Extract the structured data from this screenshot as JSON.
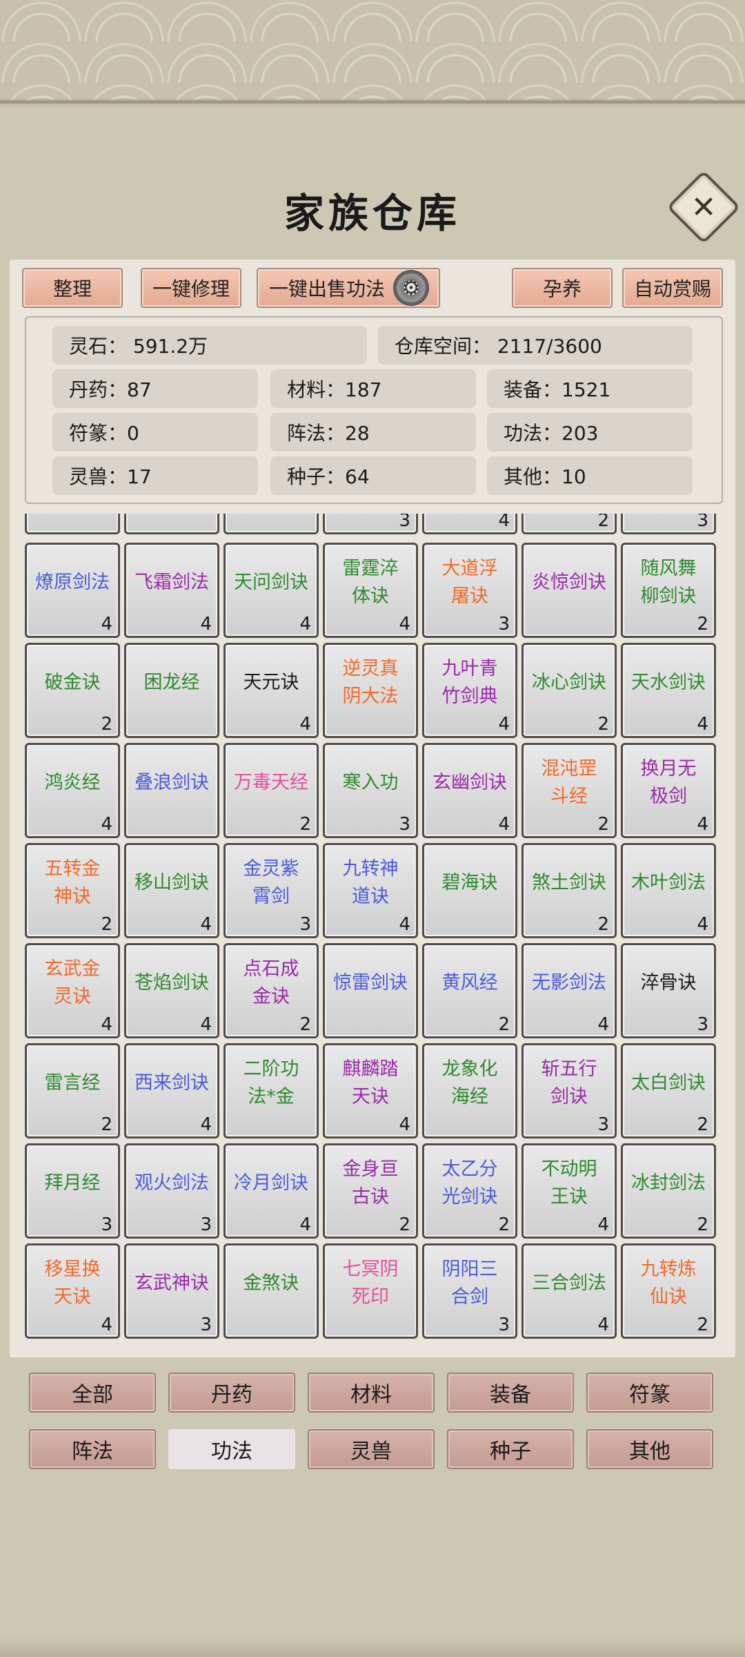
{
  "title": "家族仓库",
  "toolbar": {
    "sort": "整理",
    "repair": "一键修理",
    "sell": "一键出售功法",
    "breed": "孕养",
    "reward": "自动赏赐"
  },
  "stats": {
    "spirit_stone": "灵石：  591.2万",
    "space": "仓库空间：   2117/3600",
    "pills": "丹药：87",
    "materials": "材料：187",
    "equipment": "装备：1521",
    "talismans": "符篆：0",
    "formations": "阵法：28",
    "techniques": "功法：203",
    "beasts": "灵兽：17",
    "seeds": "种子：64",
    "others": "其他：10"
  },
  "partial_row": [
    "",
    "",
    "",
    "3",
    "4",
    "2",
    "3"
  ],
  "colors": {
    "green": "#2f8a2f",
    "blue": "#4b5bd8",
    "purple": "#9a2aa8",
    "orange": "#f06a2a",
    "pink": "#e0509a",
    "black": "#1a1a1a"
  },
  "items": [
    {
      "name": "燎原剑法",
      "count": "4",
      "color": "blue"
    },
    {
      "name": "飞霜剑法",
      "count": "4",
      "color": "purple"
    },
    {
      "name": "天问剑诀",
      "count": "4",
      "color": "green"
    },
    {
      "name": "雷霆淬体诀",
      "count": "4",
      "color": "green"
    },
    {
      "name": "大道浮屠诀",
      "count": "3",
      "color": "orange"
    },
    {
      "name": "炎惊剑诀",
      "count": "",
      "color": "purple"
    },
    {
      "name": "随风舞柳剑诀",
      "count": "2",
      "color": "green"
    },
    {
      "name": "破金诀",
      "count": "2",
      "color": "green"
    },
    {
      "name": "困龙经",
      "count": "",
      "color": "green"
    },
    {
      "name": "天元诀",
      "count": "4",
      "color": "black"
    },
    {
      "name": "逆灵真阴大法",
      "count": "",
      "color": "orange"
    },
    {
      "name": "九叶青竹剑典",
      "count": "4",
      "color": "purple"
    },
    {
      "name": "冰心剑诀",
      "count": "2",
      "color": "green"
    },
    {
      "name": "天水剑诀",
      "count": "4",
      "color": "green"
    },
    {
      "name": "鸿炎经",
      "count": "4",
      "color": "green"
    },
    {
      "name": "叠浪剑诀",
      "count": "",
      "color": "blue"
    },
    {
      "name": "万毒天经",
      "count": "2",
      "color": "pink"
    },
    {
      "name": "寒入功",
      "count": "3",
      "color": "green"
    },
    {
      "name": "玄幽剑诀",
      "count": "4",
      "color": "purple"
    },
    {
      "name": "混沌罡斗经",
      "count": "2",
      "color": "orange"
    },
    {
      "name": "换月无极剑",
      "count": "4",
      "color": "purple"
    },
    {
      "name": "五转金神诀",
      "count": "2",
      "color": "orange"
    },
    {
      "name": "移山剑诀",
      "count": "4",
      "color": "green"
    },
    {
      "name": "金灵紫霄剑",
      "count": "3",
      "color": "blue"
    },
    {
      "name": "九转神道诀",
      "count": "4",
      "color": "blue"
    },
    {
      "name": "碧海诀",
      "count": "",
      "color": "green"
    },
    {
      "name": "煞土剑诀",
      "count": "2",
      "color": "green"
    },
    {
      "name": "木叶剑法",
      "count": "4",
      "color": "green"
    },
    {
      "name": "玄武金灵诀",
      "count": "4",
      "color": "orange"
    },
    {
      "name": "苍焰剑诀",
      "count": "4",
      "color": "green"
    },
    {
      "name": "点石成金诀",
      "count": "2",
      "color": "purple"
    },
    {
      "name": "惊雷剑诀",
      "count": "",
      "color": "blue"
    },
    {
      "name": "黄风经",
      "count": "2",
      "color": "blue"
    },
    {
      "name": "无影剑法",
      "count": "4",
      "color": "blue"
    },
    {
      "name": "淬骨诀",
      "count": "3",
      "color": "black"
    },
    {
      "name": "雷言经",
      "count": "2",
      "color": "green"
    },
    {
      "name": "西来剑诀",
      "count": "4",
      "color": "blue"
    },
    {
      "name": "二阶功法*金",
      "count": "",
      "color": "green"
    },
    {
      "name": "麒麟踏天诀",
      "count": "4",
      "color": "purple"
    },
    {
      "name": "龙象化海经",
      "count": "",
      "color": "green"
    },
    {
      "name": "斩五行剑诀",
      "count": "3",
      "color": "purple"
    },
    {
      "name": "太白剑诀",
      "count": "2",
      "color": "green"
    },
    {
      "name": "拜月经",
      "count": "3",
      "color": "green"
    },
    {
      "name": "观火剑法",
      "count": "3",
      "color": "blue"
    },
    {
      "name": "冷月剑诀",
      "count": "4",
      "color": "blue"
    },
    {
      "name": "金身亘古诀",
      "count": "2",
      "color": "purple"
    },
    {
      "name": "太乙分光剑诀",
      "count": "2",
      "color": "blue"
    },
    {
      "name": "不动明王诀",
      "count": "4",
      "color": "green"
    },
    {
      "name": "冰封剑法",
      "count": "2",
      "color": "green"
    },
    {
      "name": "移星换天诀",
      "count": "4",
      "color": "orange"
    },
    {
      "name": "玄武神诀",
      "count": "3",
      "color": "purple"
    },
    {
      "name": "金煞诀",
      "count": "",
      "color": "green"
    },
    {
      "name": "七冥阴死印",
      "count": "",
      "color": "pink"
    },
    {
      "name": "阴阳三合剑",
      "count": "3",
      "color": "blue"
    },
    {
      "name": "三合剑法",
      "count": "4",
      "color": "green"
    },
    {
      "name": "九转炼仙诀",
      "count": "2",
      "color": "orange"
    }
  ],
  "tabs": [
    {
      "label": "全部",
      "active": false
    },
    {
      "label": "丹药",
      "active": false
    },
    {
      "label": "材料",
      "active": false
    },
    {
      "label": "装备",
      "active": false
    },
    {
      "label": "符篆",
      "active": false
    },
    {
      "label": "阵法",
      "active": false
    },
    {
      "label": "功法",
      "active": true
    },
    {
      "label": "灵兽",
      "active": false
    },
    {
      "label": "种子",
      "active": false
    },
    {
      "label": "其他",
      "active": false
    }
  ]
}
